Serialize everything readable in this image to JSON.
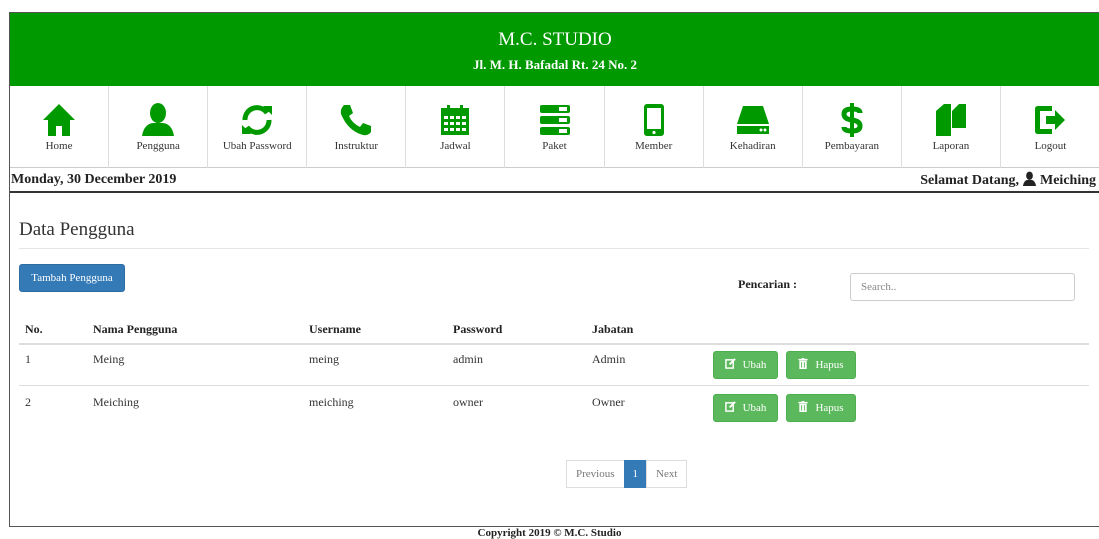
{
  "header": {
    "title": "M.C. STUDIO",
    "address": "Jl. M. H. Bafadal Rt. 24 No. 2",
    "brand_color": "#009900"
  },
  "nav": [
    {
      "label": "Home",
      "icon": "home-icon"
    },
    {
      "label": "Pengguna",
      "icon": "user-icon"
    },
    {
      "label": "Ubah Password",
      "icon": "refresh-icon"
    },
    {
      "label": "Instruktur",
      "icon": "phone-icon"
    },
    {
      "label": "Jadwal",
      "icon": "calendar-icon"
    },
    {
      "label": "Paket",
      "icon": "tasks-icon"
    },
    {
      "label": "Member",
      "icon": "phone-device-icon"
    },
    {
      "label": "Kehadiran",
      "icon": "hdd-icon"
    },
    {
      "label": "Pembayaran",
      "icon": "dollar-icon"
    },
    {
      "label": "Laporan",
      "icon": "copy-icon"
    },
    {
      "label": "Logout",
      "icon": "logout-icon"
    }
  ],
  "datebar": {
    "date": "Monday, 30 December 2019",
    "greeting": "Selamat Datang,",
    "username": "Meiching"
  },
  "main": {
    "page_title": "Data Pengguna",
    "add_button": "Tambah Pengguna",
    "search_label": "Pencarian :",
    "search_placeholder": "Search..",
    "columns": [
      "No.",
      "Nama Pengguna",
      "Username",
      "Password",
      "Jabatan"
    ],
    "rows": [
      {
        "no": "1",
        "nama": "Meing",
        "username": "meing",
        "password": "admin",
        "jabatan": "Admin"
      },
      {
        "no": "2",
        "nama": "Meiching",
        "username": "meiching",
        "password": "owner",
        "jabatan": "Owner"
      }
    ],
    "edit_label": "Ubah",
    "delete_label": "Hapus"
  },
  "pagination": {
    "previous": "Previous",
    "current": "1",
    "next": "Next"
  },
  "footer": {
    "copyright": "Copyright 2019 © M.C. Studio"
  }
}
